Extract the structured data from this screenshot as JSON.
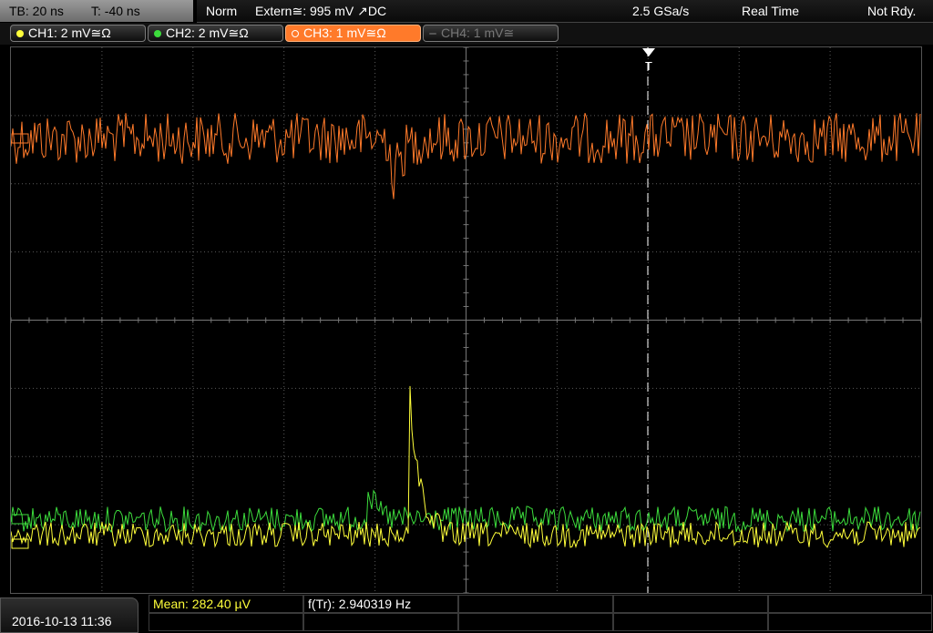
{
  "timebase": {
    "tb": "TB: 20 ns",
    "trigger_pos": "T: -40 ns"
  },
  "status": {
    "mode": "Norm",
    "trigger_source": "Extern≅: 995 mV ↗DC",
    "sample_rate": "2.5 GSa/s",
    "acq_mode": "Real Time",
    "state": "Not Rdy."
  },
  "channels": [
    {
      "label": "CH1: 2 mV≅Ω",
      "color": "#ffff3a",
      "state": "on"
    },
    {
      "label": "CH2: 2 mV≅Ω",
      "color": "#3cdc3c",
      "state": "on"
    },
    {
      "label": "CH3: 1 mV≅Ω",
      "color": "#ff7a2a",
      "state": "selected"
    },
    {
      "label": "CH4: 1 mV≅",
      "color": "#777777",
      "state": "off"
    }
  ],
  "markers": {
    "trigger": "T"
  },
  "footer": {
    "datetime": "2016-10-13 11:36",
    "mean": "Mean: 282.40 µV",
    "freq": "f(Tr): 2.940319 Hz"
  },
  "colors": {
    "ch1": "#ffff3a",
    "ch2": "#3cdc3c",
    "ch3": "#ff7a2a",
    "grid": "#5a5a5a"
  }
}
